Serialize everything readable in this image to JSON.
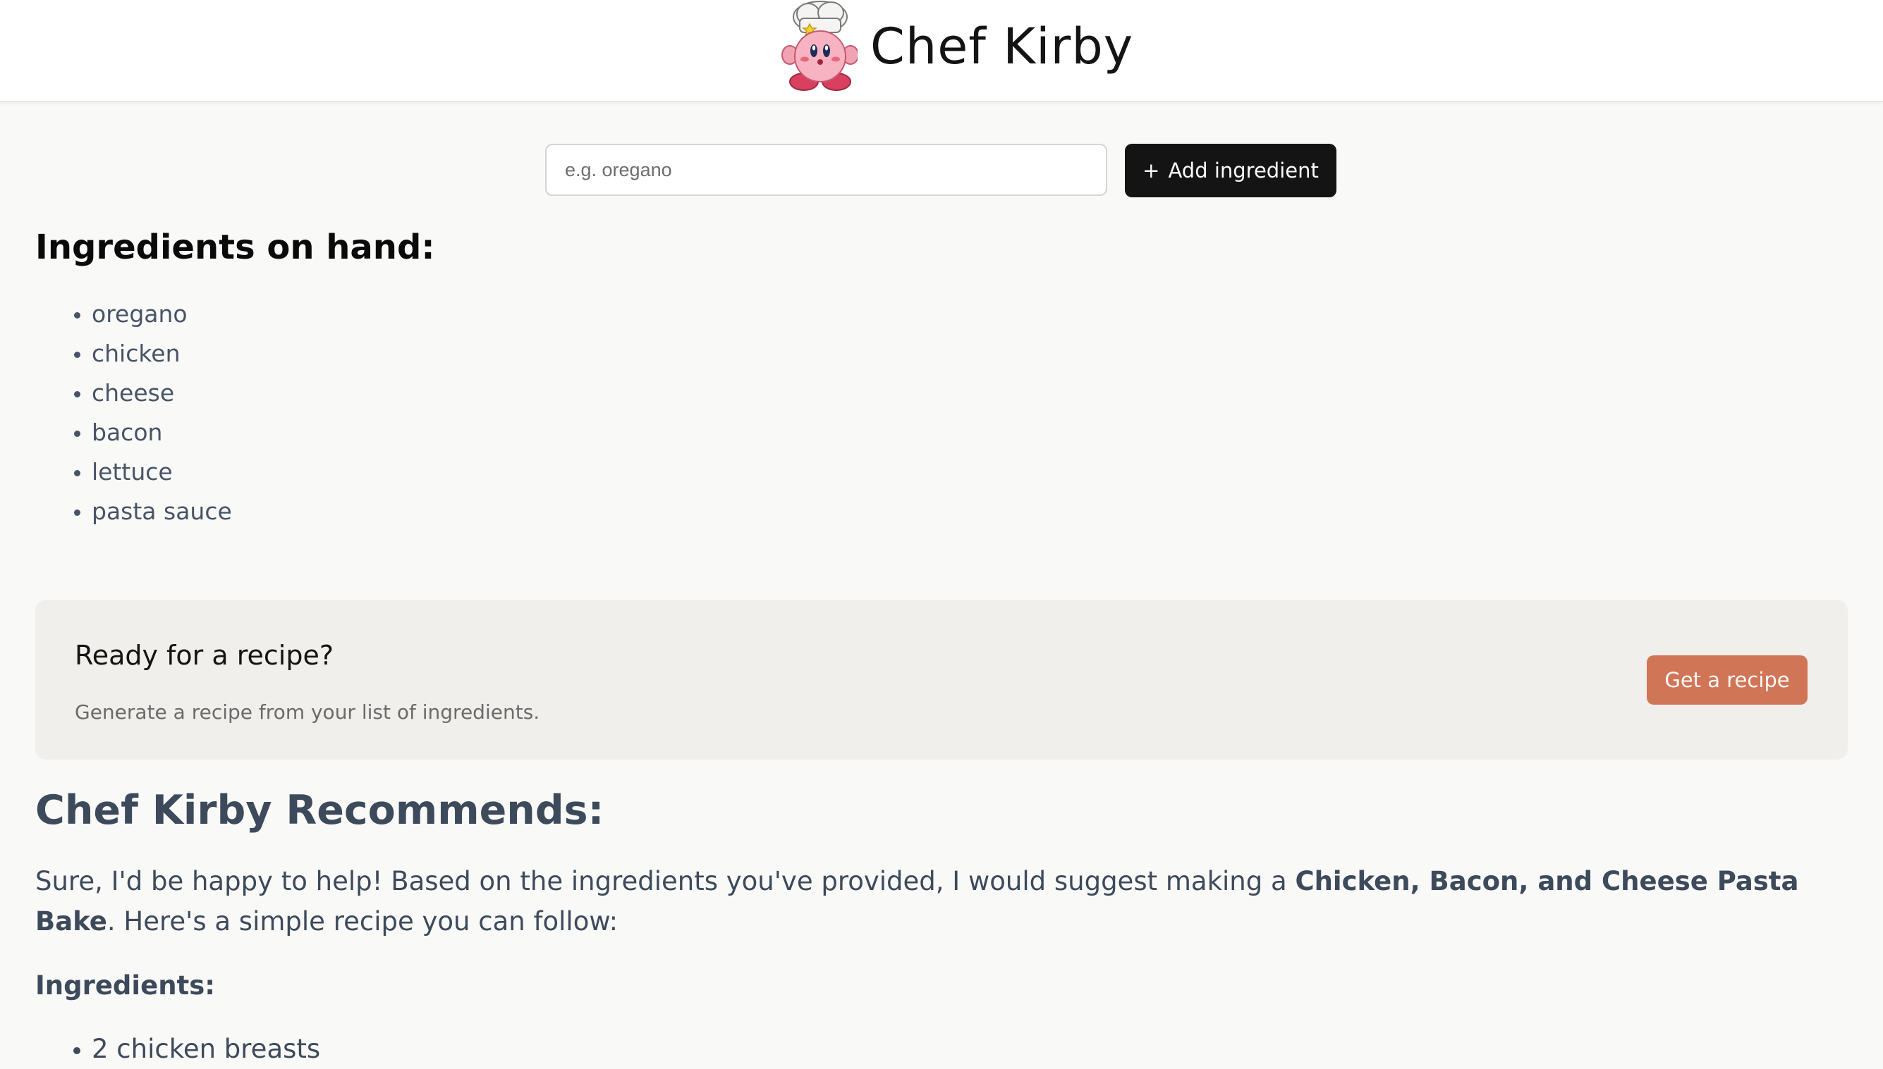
{
  "header": {
    "title": "Chef Kirby",
    "logo_icon": "chef-kirby-icon"
  },
  "form": {
    "placeholder": "e.g. oregano",
    "value": "",
    "add_button_label": "Add ingredient",
    "add_button_icon": "+"
  },
  "on_hand": {
    "title": "Ingredients on hand:",
    "items": [
      "oregano",
      "chicken",
      "cheese",
      "bacon",
      "lettuce",
      "pasta sauce"
    ]
  },
  "recipe_card": {
    "title": "Ready for a recipe?",
    "subtitle": "Generate a recipe from your list of ingredients.",
    "button_label": "Get a recipe"
  },
  "recommendation": {
    "title": "Chef Kirby Recommends:",
    "intro_before": "Sure, I'd be happy to help! Based on the ingredients you've provided, I would suggest making a ",
    "dish_name": "Chicken, Bacon, and Cheese Pasta Bake",
    "intro_after": ". Here's a simple recipe you can follow:",
    "ingredients_heading": "Ingredients:",
    "ingredients": [
      "2 chicken breasts"
    ]
  },
  "colors": {
    "accent": "#d17557",
    "dark_button": "#141414",
    "text_slate": "#3d4a5c",
    "card_background": "#f0efec"
  }
}
